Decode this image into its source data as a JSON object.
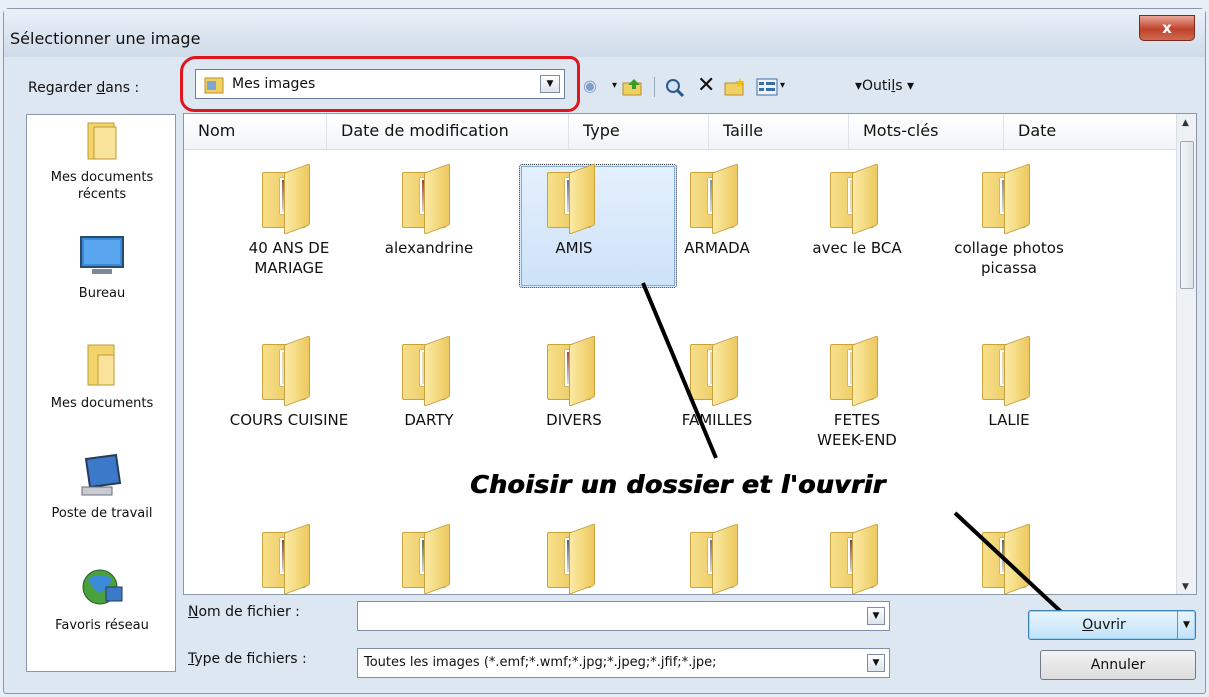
{
  "window": {
    "title": "Sélectionner une image",
    "close_label": "x"
  },
  "toolbar": {
    "look_in_label_pre": "Regarder ",
    "look_in_label_u": "d",
    "look_in_label_post": "ans :",
    "look_in_value": "Mes images",
    "tools_pre": "▾Outi",
    "tools_u": "l",
    "tools_post": "s ▾"
  },
  "places": [
    {
      "label1": "Mes documents",
      "label2": "récents",
      "icon": "recent-documents-icon"
    },
    {
      "label1": "Bureau",
      "label2": "",
      "icon": "desktop-icon"
    },
    {
      "label1": "Mes documents",
      "label2": "",
      "icon": "my-documents-icon"
    },
    {
      "label1": "Poste de travail",
      "label2": "",
      "icon": "computer-icon"
    },
    {
      "label1": "Favoris réseau",
      "label2": "",
      "icon": "network-icon"
    }
  ],
  "columns": [
    "Nom",
    "Date de modification",
    "Type",
    "Taille",
    "Mots-clés",
    "Date"
  ],
  "folders": [
    {
      "name1": "40 ANS DE",
      "name2": "MARIAGE",
      "photo": "#8a5a3c"
    },
    {
      "name1": "alexandrine",
      "name2": "",
      "photo": "#a33a2c"
    },
    {
      "name1": "AMIS",
      "name2": "",
      "photo": "#6a6a7a"
    },
    {
      "name1": "ARMADA",
      "name2": "",
      "photo": "#7a8ea0"
    },
    {
      "name1": "avec le BCA",
      "name2": "",
      "photo": "#e8d79a"
    },
    {
      "name1": "collage photos",
      "name2": "picassa",
      "photo": "#8a8a8a"
    },
    {
      "name1": "COURS CUISINE",
      "name2": "",
      "photo": "#e8d79a"
    },
    {
      "name1": "DARTY",
      "name2": "",
      "photo": "#e8d79a"
    },
    {
      "name1": "DIVERS",
      "name2": "",
      "photo": "#9a4a3a"
    },
    {
      "name1": "FAMILLES",
      "name2": "",
      "photo": "#e8d79a"
    },
    {
      "name1": "FETES",
      "name2": "WEEK-END",
      "photo": "#e8d79a"
    },
    {
      "name1": "LALIE",
      "name2": "",
      "photo": "#e8d79a"
    },
    {
      "name1": "",
      "name2": "",
      "photo": "#7a4a3a"
    },
    {
      "name1": "",
      "name2": "",
      "photo": "#5a6a4a"
    },
    {
      "name1": "",
      "name2": "",
      "photo": "#4a5a6a"
    },
    {
      "name1": "",
      "name2": "",
      "photo": "#7a6a7a"
    },
    {
      "name1": "",
      "name2": "",
      "photo": "#6a4a3a"
    },
    {
      "name1": "",
      "name2": "",
      "photo": "#5a6a5a"
    }
  ],
  "annotation": "Choisir un dossier et l'ouvrir",
  "filename": {
    "label_u": "N",
    "label_post": "om de fichier :",
    "value": ""
  },
  "filetype": {
    "label_u": "T",
    "label_post": "ype de fichiers :",
    "value": "Toutes les images (*.emf;*.wmf;*.jpg;*.jpeg;*.jfif;*.jpe;"
  },
  "buttons": {
    "open_u": "O",
    "open_post": "uvrir",
    "cancel": "Annuler"
  },
  "colors": {
    "accent": "#e3141c",
    "selection": "#cde2f8"
  }
}
